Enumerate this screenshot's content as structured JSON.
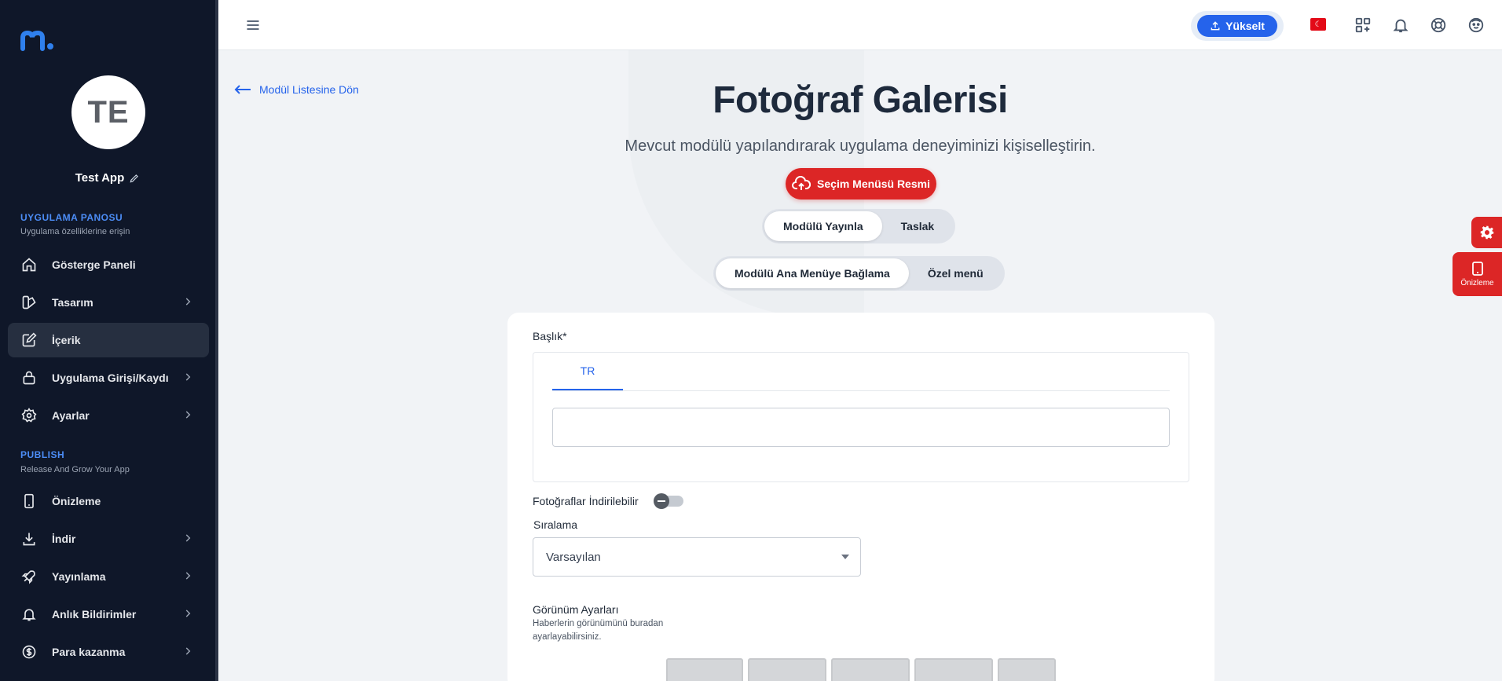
{
  "app": {
    "name": "Test App",
    "avatar_initials": "TE"
  },
  "sidebar": {
    "section1": {
      "title": "UYGULAMA PANOSU",
      "subtitle": "Uygulama özelliklerine erişin"
    },
    "items1": [
      {
        "label": "Gösterge Paneli",
        "icon": "home-icon",
        "has_chevron": false
      },
      {
        "label": "Tasarım",
        "icon": "palette-icon",
        "has_chevron": true
      },
      {
        "label": "İçerik",
        "icon": "edit-icon",
        "has_chevron": false,
        "active": true
      },
      {
        "label": "Uygulama Girişi/Kaydı",
        "icon": "lock-icon",
        "has_chevron": true
      },
      {
        "label": "Ayarlar",
        "icon": "gear-icon",
        "has_chevron": true
      }
    ],
    "section2": {
      "title": "PUBLISH",
      "subtitle": "Release And Grow Your App"
    },
    "items2": [
      {
        "label": "Önizleme",
        "icon": "phone-icon",
        "has_chevron": false
      },
      {
        "label": "İndir",
        "icon": "download-icon",
        "has_chevron": true
      },
      {
        "label": "Yayınlama",
        "icon": "rocket-icon",
        "has_chevron": true
      },
      {
        "label": "Anlık Bildirimler",
        "icon": "bell-icon",
        "has_chevron": true
      },
      {
        "label": "Para kazanma",
        "icon": "dollar-icon",
        "has_chevron": true
      }
    ]
  },
  "topbar": {
    "upgrade_label": "Yükselt",
    "flag": "TR flag",
    "icons": [
      "apps-add-icon",
      "bell-icon",
      "help-icon",
      "profile-icon"
    ]
  },
  "main": {
    "back_label": "Modül Listesine Dön",
    "title": "Fotoğraf Galerisi",
    "subtitle": "Mevcut modülü yapılandırarak uygulama deneyiminizi kişiselleştirin.",
    "menu_image_button": "Seçim Menüsü Resmi",
    "publish_toggle": {
      "options": [
        "Modülü Yayınla",
        "Taslak"
      ],
      "selected": "Modülü Yayınla"
    },
    "menu_toggle": {
      "options": [
        "Modülü Ana Menüye Bağlama",
        "Özel menü"
      ],
      "selected": "Modülü Ana Menüye Bağlama"
    }
  },
  "form": {
    "title_label": "Başlık*",
    "lang_tab": "TR",
    "title_value": "",
    "downloadable_label": "Fotoğraflar İndirilebilir",
    "downloadable_on": false,
    "sort_label": "Sıralama",
    "sort_value": "Varsayılan",
    "view_settings_title": "Görünüm Ayarları",
    "view_settings_desc_1": "Haberlerin görünümünü buradan",
    "view_settings_desc_2": "ayarlayabilirsiniz."
  },
  "floating": {
    "preview_label": "Önizleme"
  },
  "colors": {
    "sidebar_bg": "#0f1729",
    "accent_blue": "#2563eb",
    "accent_red": "#dc2626"
  }
}
